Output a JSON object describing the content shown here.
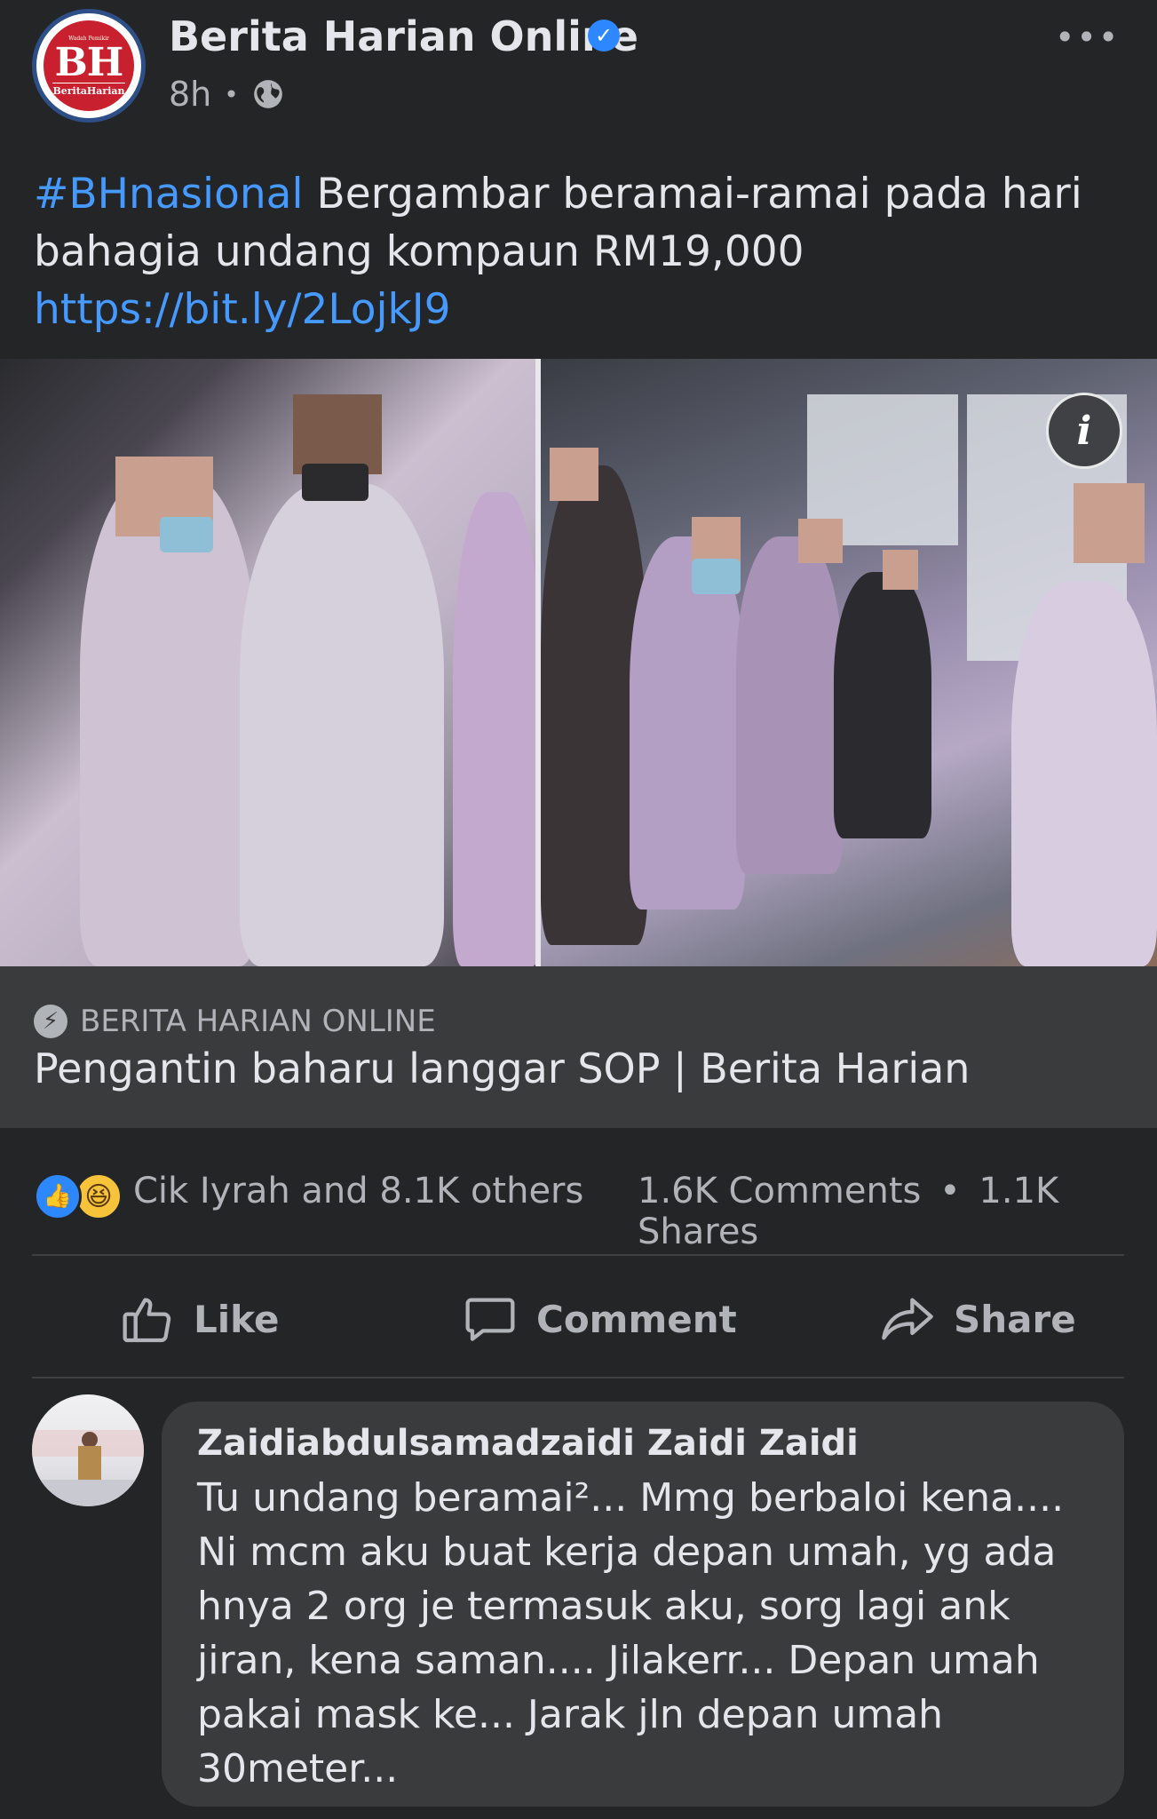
{
  "post": {
    "page_name": "Berita Harian Online",
    "verified_icon": "verified-check-icon",
    "time": "8h",
    "separator": "•",
    "privacy_icon": "globe-icon",
    "more_label": "•••",
    "logo": {
      "mark": "BH",
      "tagline": "Wadah Pemikir",
      "subtext": "BeritaHarian"
    },
    "hashtag": "#BHnasional",
    "text": " Bergambar beramai-ramai pada hari bahagia undang kompaun RM19,000",
    "link": "https://bit.ly/2LojkJ9"
  },
  "media": {
    "info_label": "i"
  },
  "preview": {
    "source_icon": "bolt-icon",
    "source": "BERITA HARIAN ONLINE",
    "title": "Pengantin baharu langgar SOP | Berita Harian"
  },
  "stats": {
    "reactions_text": "Cik Iyrah and 8.1K others",
    "comments": "1.6K Comments",
    "dot": "•",
    "shares": "1.1K Shares"
  },
  "actions": {
    "like": "Like",
    "comment": "Comment",
    "share": "Share"
  },
  "comment": {
    "author": "Zaidiabdulsamadzaidi Zaidi Zaidi",
    "text": "Tu undang beramai²... Mmg berbaloi kena.... Ni mcm aku buat kerja depan umah, yg ada hnya 2 org je termasuk aku, sorg lagi ank jiran, kena saman.... Jilakerr... Depan umah pakai mask ke... Jarak jln depan umah 30meter..."
  },
  "colors": {
    "background": "#242526",
    "link": "#4599ff",
    "secondary_text": "#b0b3b8",
    "bubble": "#3a3b3c"
  }
}
